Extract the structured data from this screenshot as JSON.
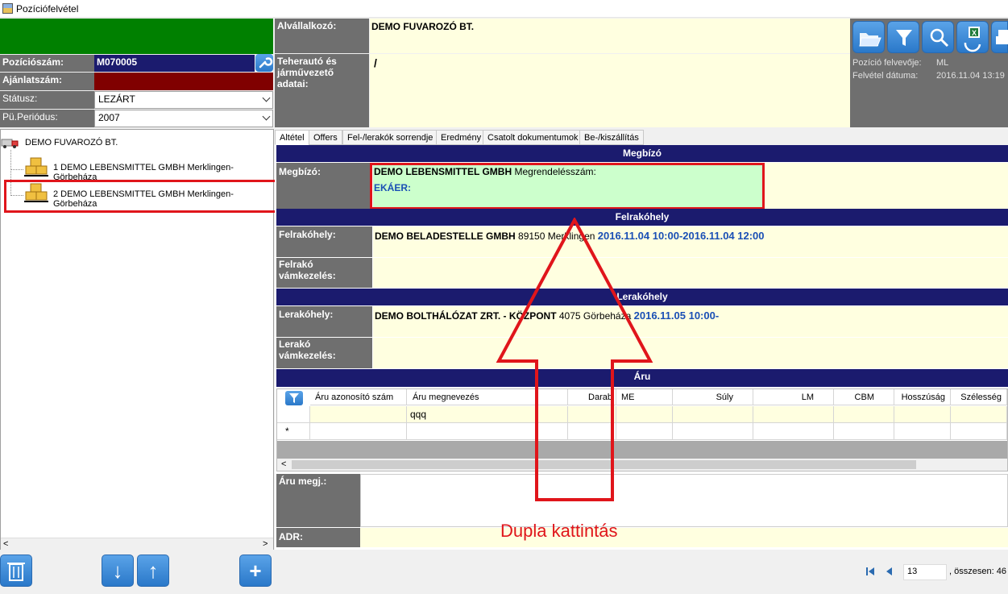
{
  "window": {
    "title": "Pozíciófelvétel"
  },
  "left": {
    "pozicioszam_label": "Pozíciószám:",
    "pozicioszam_value": "M070005",
    "ajanlatszam_label": "Ajánlatszám:",
    "statusz_label": "Státusz:",
    "statusz_value": "LEZÁRT",
    "periodus_label": "Pü.Periódus:",
    "periodus_value": "2007"
  },
  "tree": {
    "root": "DEMO FUVAROZÓ BT.",
    "items": [
      {
        "label": "1 DEMO LEBENSMITTEL GMBH Merklingen-Görbeháza"
      },
      {
        "label": "2 DEMO LEBENSMITTEL GMBH Merklingen-Görbeháza"
      }
    ]
  },
  "header": {
    "alvallalkozo_label": "Alvállalkozó:",
    "alvallalkozo_value": "DEMO FUVAROZÓ BT.",
    "teherauto_label": "Teherautó és járművezető adatai:",
    "teherauto_value": "/",
    "felvevo_label": "Pozíció felvevője:",
    "felvevo_value": "ML",
    "datum_label": "Felvétel dátuma:",
    "datum_value": "2016.11.04 13:19"
  },
  "tabs": [
    {
      "label": "Altétel"
    },
    {
      "label": "Offers"
    },
    {
      "label": "Fel-/lerakók sorrendje"
    },
    {
      "label": "Eredmény"
    },
    {
      "label": "Csatolt dokumentumok"
    },
    {
      "label": "Be-/kiszállítás"
    }
  ],
  "sections": {
    "megbizo_header": "Megbízó",
    "megbizo_label": "Megbízó:",
    "megbizo_name": "DEMO LEBENSMITTEL GMBH",
    "megrendeles": "Megrendelésszám:",
    "ekaer": "EKÁER:",
    "felrako_header": "Felrakóhely",
    "felrako_label": "Felrakóhely:",
    "felrako_name": "DEMO BELADESTELLE GMBH",
    "felrako_addr": "89150 Merklingen",
    "felrako_time": "2016.11.04 10:00-2016.11.04 12:00",
    "felrako_vam_label": "Felrakó vámkezelés:",
    "lerako_header": "Lerakóhely",
    "lerako_label": "Lerakóhely:",
    "lerako_name": "DEMO BOLTHÁLÓZAT ZRT. - KÖZPONT",
    "lerako_addr": "4075 Görbeháza",
    "lerako_time": "2016.11.05 10:00-",
    "lerako_vam_label": "Lerakó vámkezelés:",
    "aru_header": "Áru"
  },
  "grid": {
    "columns": [
      "Áru azonosító szám",
      "Áru megnevezés",
      "Darab",
      "ME",
      "Súly",
      "LM",
      "CBM",
      "Hosszúság",
      "Szélesség"
    ],
    "row1": {
      "megnevezes": "qqq"
    },
    "new_row_marker": "*"
  },
  "notes": {
    "aru_megj_label": "Áru megj.:",
    "adr_label": "ADR:"
  },
  "annotation": {
    "text": "Dupla kattintás",
    "color": "#e0151b"
  },
  "pager": {
    "current": "13",
    "total_text": ", összesen: 46"
  },
  "colors": {
    "navy": "#1b1b6e",
    "label_gray": "#6f6f6f",
    "light_yellow": "#ffffe0",
    "light_green": "#ccffcc",
    "accent_red": "#e0151b",
    "green_panel": "#008000",
    "dark_red": "#800000"
  }
}
